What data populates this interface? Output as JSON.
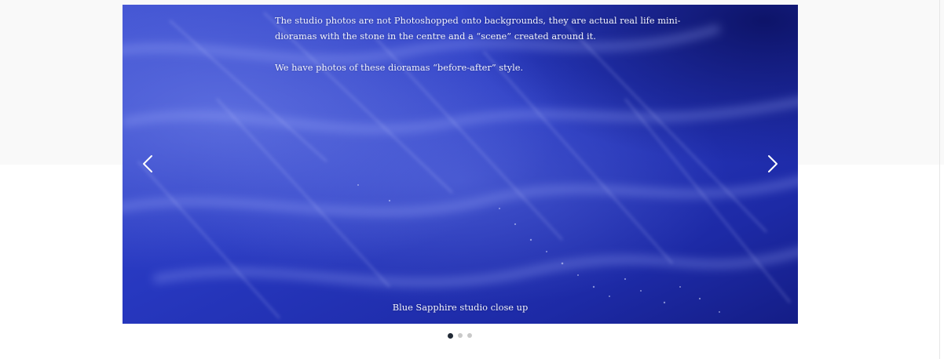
{
  "slide": {
    "paragraphs": [
      "The studio photos are not Photoshopped onto backgrounds, they are actual real life mini-dioramas with the stone in the centre and a “scene” created around it.",
      "We have photos of these dioramas “before-after” style."
    ],
    "caption": "Blue Sapphire studio close up"
  },
  "navigation": {
    "prev_icon": "chevron-left-icon",
    "next_icon": "chevron-right-icon"
  },
  "pagination": {
    "dot_count": 3,
    "active_index": 0,
    "active_color": "#222a36",
    "inactive_color": "#c9c9c9"
  },
  "colors": {
    "top_band": "#f9f9f9",
    "slide_base": "#2332b8",
    "slide_text": "#f2f4ff"
  }
}
